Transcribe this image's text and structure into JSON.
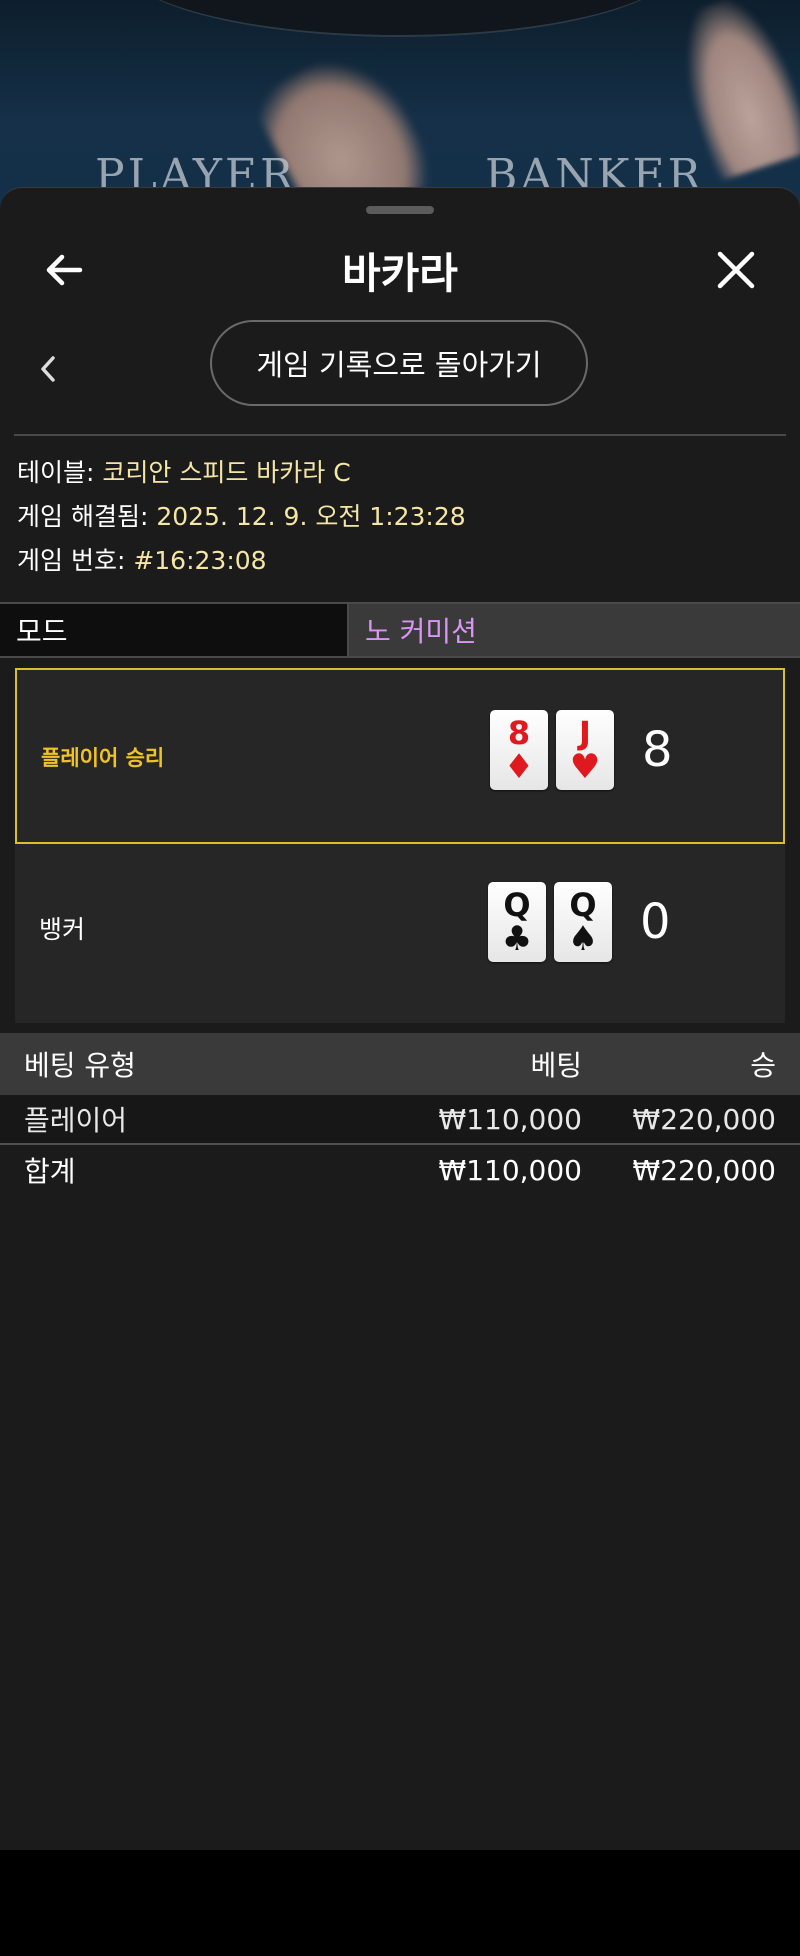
{
  "video": {
    "player_label": "PLAYER",
    "banker_label": "BANKER"
  },
  "header": {
    "title": "바카라",
    "back_icon": "arrow-left-icon",
    "close_icon": "close-icon"
  },
  "subnav": {
    "back_chevron_icon": "chevron-left-icon",
    "history_button_label": "게임 기록으로 돌아가기"
  },
  "info": {
    "table_label": "테이블:",
    "table_value": "코리안 스피드 바카라 C",
    "resolved_label": "게임 해결됨:",
    "resolved_value": "2025. 12. 9. 오전 1:23:28",
    "game_number_label": "게임 번호:",
    "game_number_value": "#16:23:08"
  },
  "mode": {
    "label": "모드",
    "value": "노 커미션"
  },
  "result": {
    "player": {
      "label": "플레이어 승리",
      "score": "8",
      "cards": [
        {
          "rank": "8",
          "suit": "♦",
          "color": "red"
        },
        {
          "rank": "J",
          "suit": "♥",
          "color": "red"
        }
      ]
    },
    "banker": {
      "label": "뱅커",
      "score": "0",
      "cards": [
        {
          "rank": "Q",
          "suit": "♣",
          "color": "black"
        },
        {
          "rank": "Q",
          "suit": "♠",
          "color": "black"
        }
      ]
    }
  },
  "bets": {
    "headers": {
      "type": "베팅 유형",
      "bet": "베팅",
      "win": "승"
    },
    "rows": [
      {
        "type": "플레이어",
        "bet": "₩110,000",
        "win": "₩220,000"
      }
    ],
    "total": {
      "label": "합계",
      "bet": "₩110,000",
      "win": "₩220,000"
    }
  },
  "colors": {
    "accent_gold": "#f0c325",
    "info_value": "#f5e6a6",
    "mode_value": "#d995f2",
    "sheet_bg": "#1b1b1b"
  }
}
